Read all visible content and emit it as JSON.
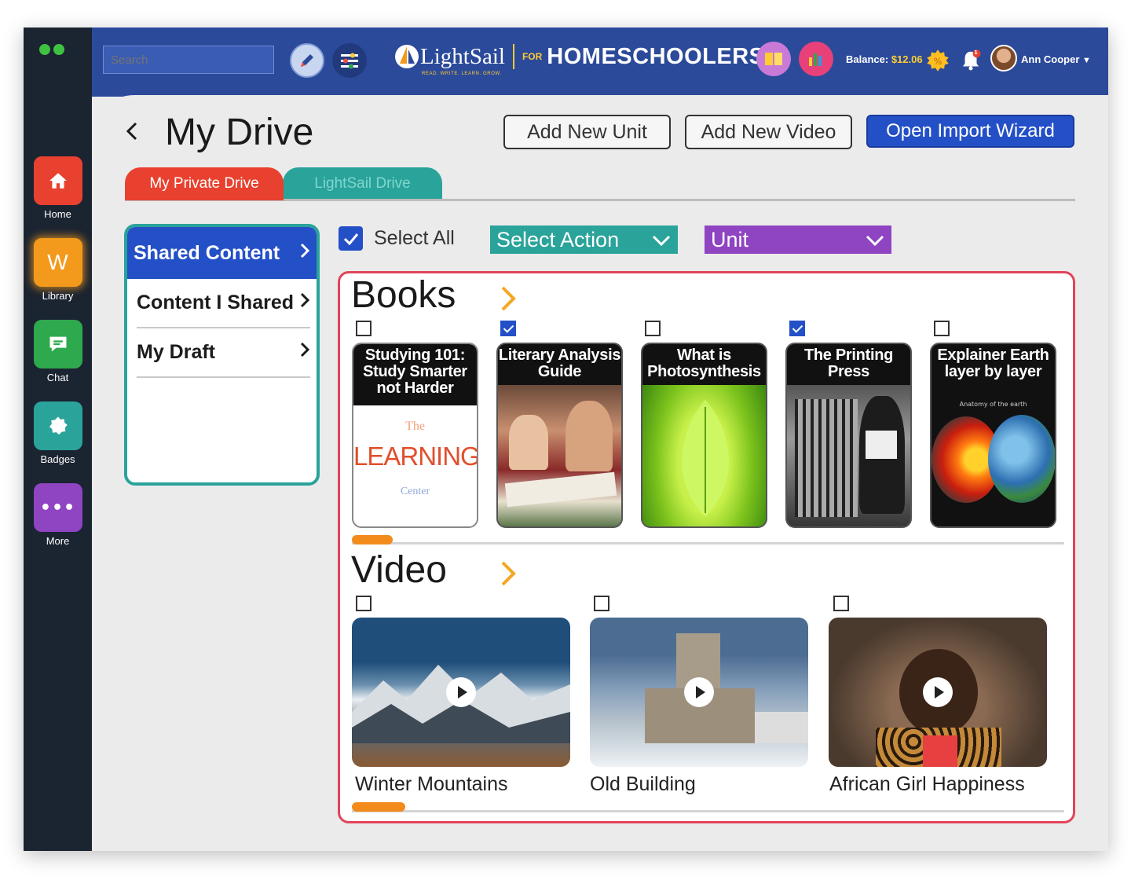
{
  "topbar": {
    "search_placeholder": "Search",
    "logo_name": "LightSail",
    "logo_tagline": "READ. WRITE. LEARN. GROW.",
    "logo_for": "FOR",
    "logo_product": "HOMESCHOOLERS",
    "balance_label": "Balance:",
    "balance_value": "$12.06",
    "notification_badge": "1",
    "user_name": "Ann Cooper"
  },
  "sidebar": {
    "items": [
      {
        "label": "Home",
        "icon": "home-icon",
        "color": "#e8412f"
      },
      {
        "label": "Library",
        "icon": "w-icon",
        "color": "#f39a1c"
      },
      {
        "label": "Chat",
        "icon": "chat-icon",
        "color": "#2ea94d"
      },
      {
        "label": "Badges",
        "icon": "badge-icon",
        "color": "#2aa39a"
      },
      {
        "label": "More",
        "icon": "more-icon",
        "color": "#8f44c2"
      }
    ]
  },
  "page": {
    "title": "My Drive",
    "add_unit": "Add New Unit",
    "add_video": "Add New Video",
    "import_wizard": "Open Import Wizard",
    "tabs": [
      "My Private Drive",
      "LightSail Drive"
    ]
  },
  "drive_nav": {
    "active": "Shared Content",
    "items": [
      "Content I Shared",
      "My Draft"
    ]
  },
  "toolbar": {
    "select_all": "Select All",
    "select_action": "Select Action",
    "unit": "Unit"
  },
  "books": {
    "title": "Books",
    "items": [
      {
        "title": "Studying 101: Study Smarter not Harder",
        "checked": false,
        "cover_the": "The",
        "cover_word": "LEARNING",
        "cover_center": "Center"
      },
      {
        "title": "Literary Analysis Guide",
        "checked": true
      },
      {
        "title": "What is Photosynthesis",
        "checked": false
      },
      {
        "title": "The Printing Press",
        "checked": true
      },
      {
        "title": "Explainer Earth layer by layer",
        "checked": false,
        "cover_sub": "Anatomy of the earth"
      }
    ]
  },
  "videos": {
    "title": "Video",
    "items": [
      {
        "caption": "Winter Mountains",
        "checked": false
      },
      {
        "caption": "Old Building",
        "checked": false
      },
      {
        "caption": "African Girl Happiness",
        "checked": false
      }
    ]
  },
  "colors": {
    "accent_blue": "#2450c7",
    "teal": "#2aa39a",
    "red": "#e0455a",
    "orange": "#f28a1c",
    "purple": "#8f44c2"
  }
}
